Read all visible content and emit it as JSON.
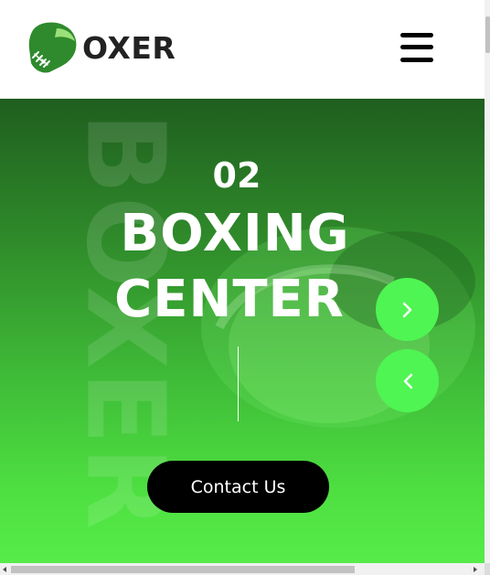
{
  "header": {
    "logo_text": "OXER",
    "menu_icon": "hamburger-menu-icon"
  },
  "hero": {
    "watermark": "BOXER",
    "slide_number": "02",
    "title_line1": "BOXING",
    "title_line2": "CENTER",
    "cta_label": "Contact Us",
    "next_icon": "chevron-right-icon",
    "prev_icon": "chevron-left-icon"
  },
  "colors": {
    "accent_green": "#4ff552",
    "hero_dark": "#1f5e1f",
    "hero_light": "#56ec49",
    "button_bg": "#000000",
    "logo_text": "#222222"
  }
}
